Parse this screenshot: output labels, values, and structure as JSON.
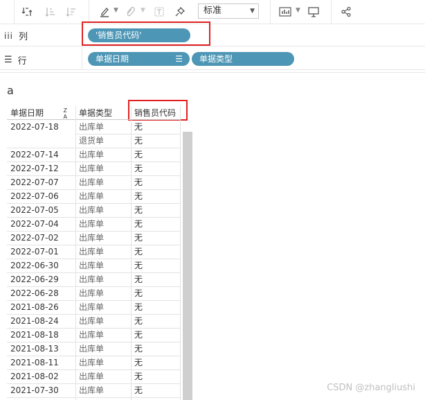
{
  "toolbar": {
    "icons": [
      "swap-rows-columns-icon",
      "sort-ascending-icon",
      "sort-descending-icon",
      "highlight-icon",
      "paperclip-icon",
      "label-icon",
      "pin-icon",
      "show-me-icon",
      "presentation-icon",
      "share-icon"
    ],
    "view_size": "标准"
  },
  "columns_shelf": {
    "label": "列",
    "pills": [
      "'销售员代码'"
    ]
  },
  "rows_shelf": {
    "label": "行",
    "pills": [
      "单据日期",
      "单据类型"
    ]
  },
  "sheet": {
    "title": "a"
  },
  "table": {
    "headers": [
      "单据日期",
      "单据类型",
      "销售员代码"
    ],
    "rows": [
      {
        "date": "2022-07-18",
        "type": "出库单",
        "value": "无"
      },
      {
        "date": "",
        "type": "退货单",
        "value": "无"
      },
      {
        "date": "2022-07-14",
        "type": "出库单",
        "value": "无"
      },
      {
        "date": "2022-07-12",
        "type": "出库单",
        "value": "无"
      },
      {
        "date": "2022-07-07",
        "type": "出库单",
        "value": "无"
      },
      {
        "date": "2022-07-06",
        "type": "出库单",
        "value": "无"
      },
      {
        "date": "2022-07-05",
        "type": "出库单",
        "value": "无"
      },
      {
        "date": "2022-07-04",
        "type": "出库单",
        "value": "无"
      },
      {
        "date": "2022-07-02",
        "type": "出库单",
        "value": "无"
      },
      {
        "date": "2022-07-01",
        "type": "出库单",
        "value": "无"
      },
      {
        "date": "2022-06-30",
        "type": "出库单",
        "value": "无"
      },
      {
        "date": "2022-06-29",
        "type": "出库单",
        "value": "无"
      },
      {
        "date": "2022-06-28",
        "type": "出库单",
        "value": "无"
      },
      {
        "date": "2021-08-26",
        "type": "出库单",
        "value": "无"
      },
      {
        "date": "2021-08-24",
        "type": "出库单",
        "value": "无"
      },
      {
        "date": "2021-08-18",
        "type": "出库单",
        "value": "无"
      },
      {
        "date": "2021-08-13",
        "type": "出库单",
        "value": "无"
      },
      {
        "date": "2021-08-11",
        "type": "出库单",
        "value": "无"
      },
      {
        "date": "2021-08-02",
        "type": "出库单",
        "value": "无"
      },
      {
        "date": "2021-07-30",
        "type": "出库单",
        "value": "无"
      }
    ]
  },
  "watermark": "CSDN @zhangliushi",
  "colors": {
    "pill": "#4d96b5",
    "highlight_box": "#e02020"
  }
}
